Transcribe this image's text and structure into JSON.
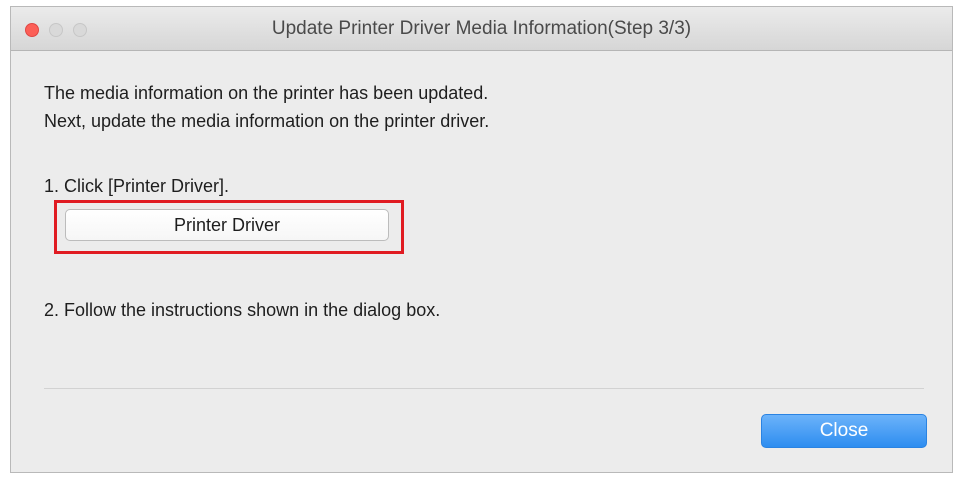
{
  "window": {
    "title": "Update Printer Driver Media Information(Step 3/3)"
  },
  "message": {
    "line1": "The media information on the printer has been updated.",
    "line2": "Next, update the media information on the printer driver."
  },
  "steps": {
    "step1_text": "1. Click [Printer Driver].",
    "printer_driver_button_label": "Printer Driver",
    "step2_text": "2. Follow the instructions shown in the dialog box."
  },
  "footer": {
    "close_label": "Close"
  },
  "colors": {
    "highlight_border": "#e01b22",
    "primary_button": "#2d8df0",
    "close_traffic_light": "#fc5f57"
  }
}
